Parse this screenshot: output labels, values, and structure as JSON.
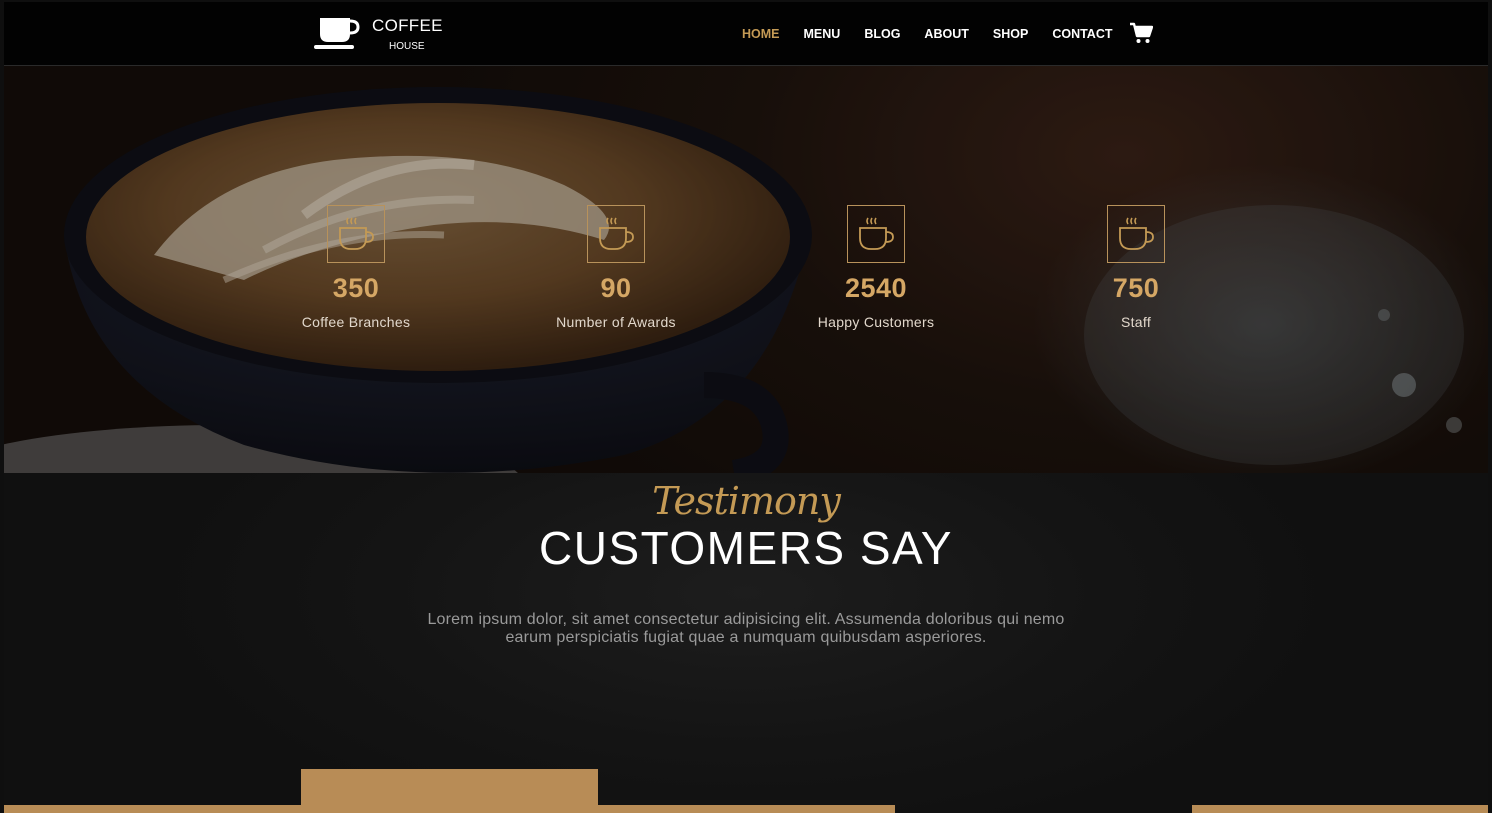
{
  "brand": {
    "name": "COFFEE",
    "sub": "HOUSE",
    "icon": "coffee-cup-icon"
  },
  "nav": {
    "items": [
      {
        "label": "HOME",
        "active": true
      },
      {
        "label": "MENU",
        "active": false
      },
      {
        "label": "BLOG",
        "active": false
      },
      {
        "label": "ABOUT",
        "active": false
      },
      {
        "label": "SHOP",
        "active": false
      },
      {
        "label": "CONTACT",
        "active": false
      }
    ],
    "cart_icon": "shopping-cart-icon"
  },
  "stats": [
    {
      "value": "350",
      "label": "Coffee Branches",
      "icon": "steaming-cup-icon"
    },
    {
      "value": "90",
      "label": "Number of Awards",
      "icon": "steaming-cup-icon"
    },
    {
      "value": "2540",
      "label": "Happy Customers",
      "icon": "steaming-cup-icon"
    },
    {
      "value": "750",
      "label": "Staff",
      "icon": "steaming-cup-icon"
    }
  ],
  "testimony": {
    "script": "Testimony",
    "title": "CUSTOMERS SAY",
    "text": "Lorem ipsum dolor, sit amet consectetur adipisicing elit. Assumenda doloribus qui nemo earum perspiciatis fugiat quae a numquam quibusdam asperiores."
  },
  "colors": {
    "accent": "#c49a55",
    "navbar_bg": "#020202",
    "testimony_bg": "#141414",
    "gold_bar": "#b88c56"
  }
}
